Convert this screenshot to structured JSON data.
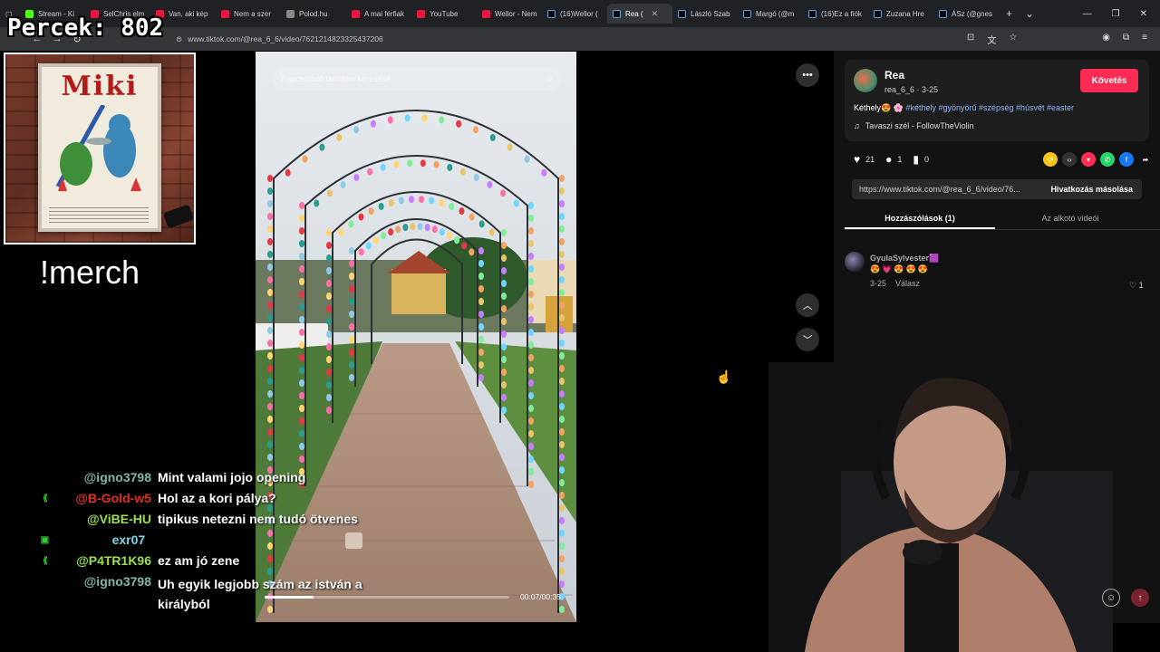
{
  "overlay": {
    "counter": "Percek: 802",
    "merch": "!merch",
    "poster_title": "Miki"
  },
  "browser": {
    "tabs": [
      {
        "label": "Stream - Ki",
        "icon": "kick"
      },
      {
        "label": "SelChris elm",
        "icon": "yt"
      },
      {
        "label": "Van, aki kép",
        "icon": "yt"
      },
      {
        "label": "Nem a szer",
        "icon": "yt"
      },
      {
        "label": "Polod.hu",
        "icon": "gen"
      },
      {
        "label": "A mai férfiak",
        "icon": "yt"
      },
      {
        "label": "YouTube",
        "icon": "yt"
      },
      {
        "label": "Wellor - Nem",
        "icon": "yt"
      },
      {
        "label": "(16)Wellor (",
        "icon": "tt"
      },
      {
        "label": "Rea (",
        "icon": "tt",
        "active": true
      },
      {
        "label": "László Szab",
        "icon": "tt"
      },
      {
        "label": "Margó (@m",
        "icon": "tt"
      },
      {
        "label": "(16)Ez a fiók",
        "icon": "tt"
      },
      {
        "label": "Zuzana Hre",
        "icon": "tt"
      },
      {
        "label": "ÁSz (@gnes",
        "icon": "tt"
      }
    ],
    "url": "www.tiktok.com/@rea_6_6/video/7621214823325437206"
  },
  "video": {
    "search_placeholder": "Kapcsolódó tartalom keresése",
    "timecode": "00:07/00:35",
    "progress_fraction": 0.2
  },
  "panel": {
    "author_name": "Rea",
    "author_sub": "rea_6_6 · 3-25",
    "follow_label": "Követés",
    "description_prefix": "Kéthely😍 🌸 ",
    "description_tags": "#kéthely #gyönyörű #szépség #húsvét #easter",
    "music": "Tavaszi szél - FollowTheViolin",
    "likes": "21",
    "comments": "1",
    "saves": "0",
    "link": "https://www.tiktok.com/@rea_6_6/video/76...",
    "copy_label": "Hivatkozás másolása",
    "tab_comments": "Hozzászólások (1)",
    "tab_creator": "Az alkotó videói"
  },
  "comment": {
    "name": "GyulaSylvester🟪",
    "emojis": "😍💗😍😍😍",
    "date": "3-25",
    "reply": "Válasz",
    "likes": "1"
  },
  "chat": [
    {
      "user": "@igno3798",
      "color": "#7fb8a8",
      "msg": "Mint valami jojo opening",
      "badge": ""
    },
    {
      "user": "@B-Gold-w5",
      "color": "#e0301e",
      "msg": "Hol az a kori pálya?",
      "badge": "⟪"
    },
    {
      "user": "@ViBE-HU",
      "color": "#9adf4f",
      "msg": "tipikus netezni nem tudó ötvenes",
      "badge": ""
    },
    {
      "user": "exr07",
      "color": "#7fd6e0",
      "msg": "",
      "badge": "▣"
    },
    {
      "user": "@P4TR1K96",
      "color": "#9adf4f",
      "msg": "ez am jó zene",
      "badge": "⟪"
    },
    {
      "user": "@igno3798",
      "color": "#7fb8a8",
      "msg": "Uh egyik legjobb szám az istván a királyból",
      "badge": ""
    }
  ]
}
